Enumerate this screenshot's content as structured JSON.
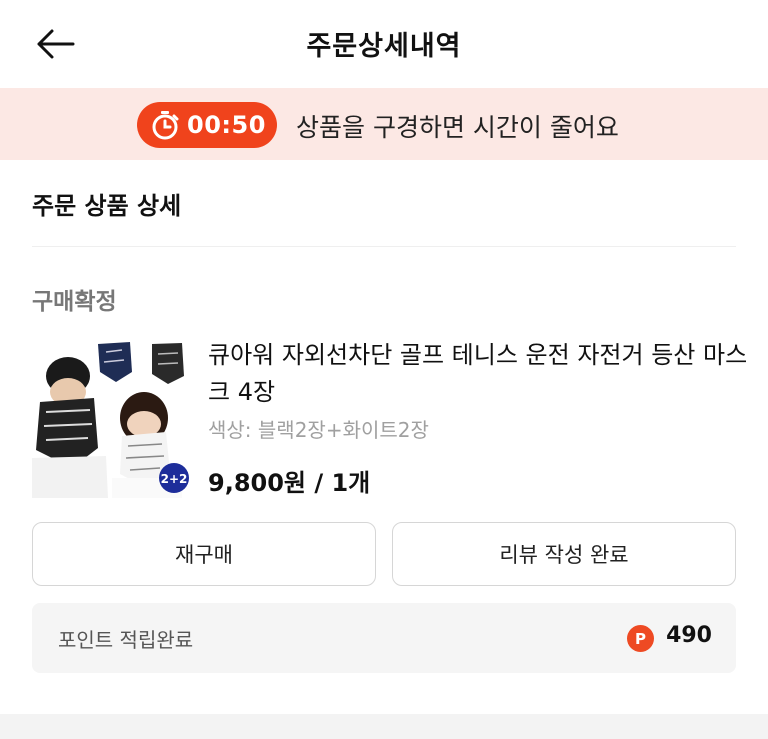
{
  "header": {
    "title": "주문상세내역",
    "back_icon": "arrow-left-icon"
  },
  "timer_banner": {
    "timer": "00:50",
    "message": "상품을 구경하면 시간이 줄어요",
    "icon": "stopwatch-icon",
    "accent_color": "#f0431c",
    "background_color": "#fce8e4"
  },
  "order_detail": {
    "section_title": "주문 상품 상세",
    "status": "구매확정",
    "product": {
      "name": "큐아워 자외선차단 골프 테니스 운전 자전거 등산 마스크 4장",
      "option": "색상: 블랙2장+화이트2장",
      "price": "9,800원 / 1개",
      "image_badge": "2+2"
    },
    "buttons": {
      "rebuy": "재구매",
      "review": "리뷰 작성 완료"
    },
    "points": {
      "label": "포인트 적립완료",
      "badge": "P",
      "value": "490"
    }
  }
}
